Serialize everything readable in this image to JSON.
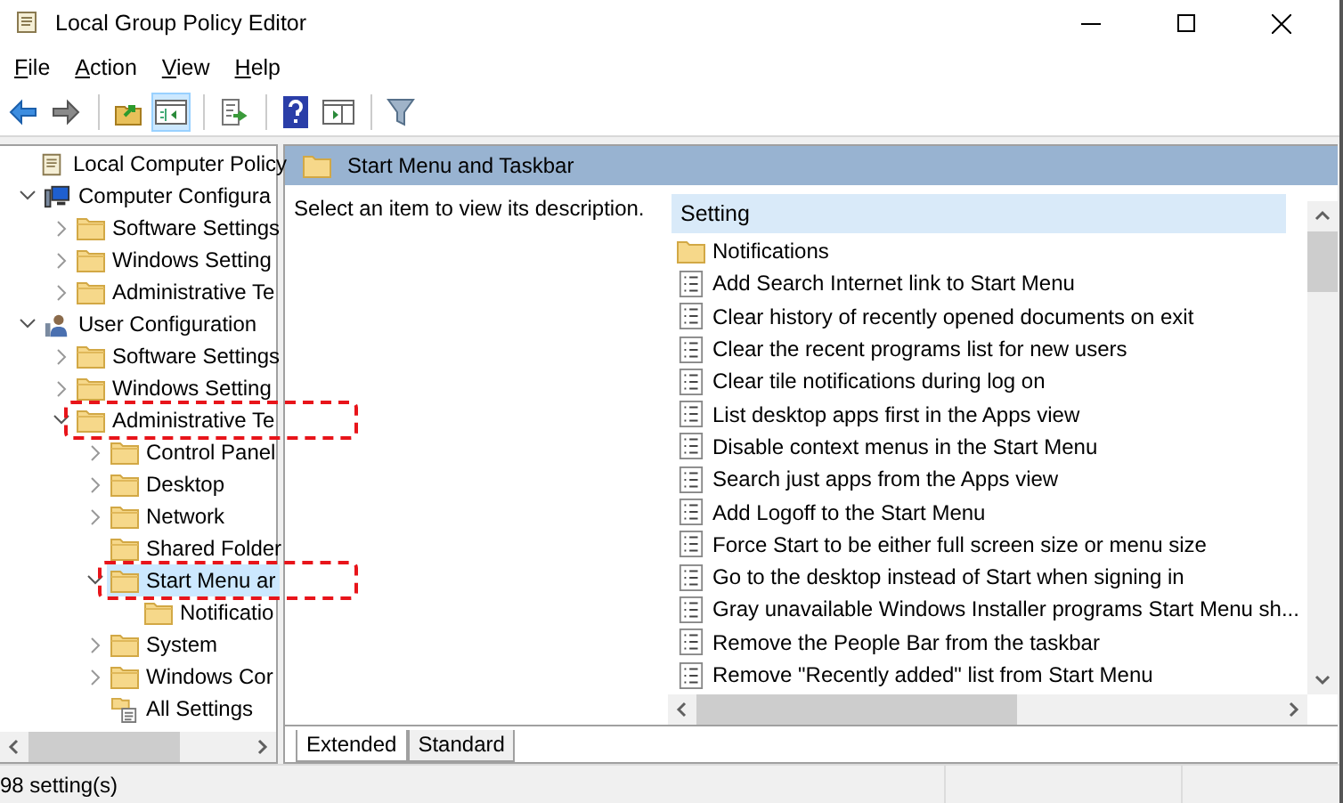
{
  "window": {
    "title": "Local Group Policy Editor"
  },
  "menu": [
    "File",
    "Action",
    "View",
    "Help"
  ],
  "toolbar": [
    {
      "kind": "back",
      "pressed": false
    },
    {
      "kind": "forward",
      "pressed": false
    },
    {
      "kind": "up",
      "pressed": false
    },
    {
      "kind": "tree",
      "pressed": true
    },
    {
      "kind": "export",
      "pressed": false
    },
    {
      "kind": "help",
      "pressed": false
    },
    {
      "kind": "pane",
      "pressed": false
    },
    {
      "kind": "filter",
      "pressed": false
    }
  ],
  "tree": [
    {
      "label": "Local Computer Policy",
      "kind": "scroll",
      "selected": false,
      "marked": false,
      "children": [
        {
          "label": "Computer Configura",
          "kind": "computer",
          "expanded": true,
          "selected": false,
          "marked": false,
          "children": [
            {
              "label": "Software Settings",
              "kind": "folder",
              "expanded": false,
              "selected": false,
              "marked": false
            },
            {
              "label": "Windows Setting",
              "kind": "folder",
              "expanded": false,
              "selected": false,
              "marked": false
            },
            {
              "label": "Administrative Te",
              "kind": "folder",
              "expanded": false,
              "selected": false,
              "marked": false
            }
          ]
        },
        {
          "label": "User Configuration",
          "kind": "user",
          "expanded": true,
          "selected": false,
          "marked": false,
          "children": [
            {
              "label": "Software Settings",
              "kind": "folder",
              "expanded": false,
              "selected": false,
              "marked": false
            },
            {
              "label": "Windows Setting",
              "kind": "folder",
              "expanded": false,
              "selected": false,
              "marked": false
            },
            {
              "label": "Administrative Te",
              "kind": "folder",
              "expanded": true,
              "selected": false,
              "marked": true,
              "children": [
                {
                  "label": "Control Panel",
                  "kind": "folder",
                  "expanded": false,
                  "selected": false,
                  "marked": false
                },
                {
                  "label": "Desktop",
                  "kind": "folder",
                  "expanded": false,
                  "selected": false,
                  "marked": false
                },
                {
                  "label": "Network",
                  "kind": "folder",
                  "expanded": false,
                  "selected": false,
                  "marked": false
                },
                {
                  "label": "Shared Folder",
                  "kind": "folder",
                  "selected": false,
                  "marked": false
                },
                {
                  "label": "Start Menu ar",
                  "kind": "folder",
                  "expanded": true,
                  "selected": true,
                  "marked": true,
                  "children": [
                    {
                      "label": "Notificatio",
                      "kind": "folder",
                      "selected": false,
                      "marked": false
                    }
                  ]
                },
                {
                  "label": "System",
                  "kind": "folder",
                  "expanded": false,
                  "selected": false,
                  "marked": false
                },
                {
                  "label": "Windows Cor",
                  "kind": "folder",
                  "expanded": false,
                  "selected": false,
                  "marked": false
                },
                {
                  "label": "All Settings",
                  "kind": "settings",
                  "selected": false,
                  "marked": false
                }
              ]
            }
          ]
        }
      ]
    }
  ],
  "pane": {
    "title": "Start Menu and Taskbar",
    "description": "Select an item to view its description.",
    "column": "Setting",
    "rows": [
      {
        "kind": "folder",
        "label": "Notifications"
      },
      {
        "kind": "setting",
        "label": "Add Search Internet link to Start Menu"
      },
      {
        "kind": "setting",
        "label": "Clear history of recently opened documents on exit"
      },
      {
        "kind": "setting",
        "label": "Clear the recent programs list for new users"
      },
      {
        "kind": "setting",
        "label": "Clear tile notifications during log on"
      },
      {
        "kind": "setting",
        "label": "List desktop apps first in the Apps view"
      },
      {
        "kind": "setting",
        "label": "Disable context menus in the Start Menu"
      },
      {
        "kind": "setting",
        "label": "Search just apps from the Apps view"
      },
      {
        "kind": "setting",
        "label": "Add Logoff to the Start Menu"
      },
      {
        "kind": "setting",
        "label": "Force Start to be either full screen size or menu size"
      },
      {
        "kind": "setting",
        "label": "Go to the desktop instead of Start when signing in"
      },
      {
        "kind": "setting",
        "label": "Gray unavailable Windows Installer programs Start Menu sh..."
      },
      {
        "kind": "setting",
        "label": "Remove the People Bar from the taskbar"
      },
      {
        "kind": "setting",
        "label": "Remove \"Recently added\" list from Start Menu"
      }
    ],
    "tabs": [
      {
        "label": "Extended",
        "selected": true
      },
      {
        "label": "Standard",
        "selected": false
      }
    ]
  },
  "status_bar": "98 setting(s)"
}
